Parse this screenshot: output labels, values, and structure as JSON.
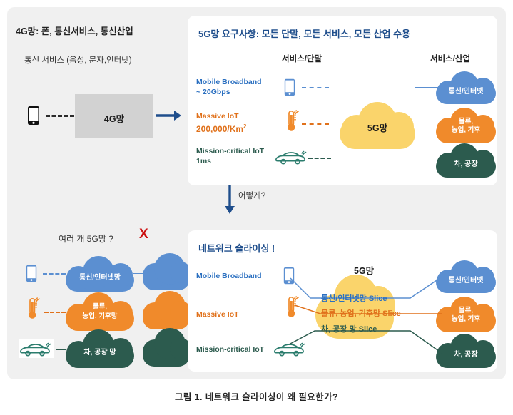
{
  "figure": {
    "caption": "그림 1.  네트워크 슬라이싱이  왜  필요한가?"
  },
  "colors": {
    "canvas_bg": "#f0f0f0",
    "panel_bg": "#ffffff",
    "blue": "#5b8fd1",
    "orange": "#f08a2b",
    "green": "#2c5b4e",
    "yellow": "#fad46b",
    "gray_cloud": "#d2d2d2",
    "navy_arrow": "#1f4e8c",
    "red_x": "#cc1111"
  },
  "panel_4g": {
    "title": "4G망: 폰, 통신서비스, 통신산업",
    "subtitle": "통신 서비스 (음성, 문자,인터넷)",
    "device_icon": "phone-icon",
    "connector": "dashed-line",
    "cloud_label": "4G망",
    "transition_icon": "right-arrow-icon"
  },
  "panel_5g_requirements": {
    "title": "5G망 요구사항: 모든 단말, 모든 서비스, 모든 산업 수용",
    "column_headers": {
      "left": "서비스/단말",
      "right": "서비스/산업"
    },
    "center_cloud_label": "5G망",
    "services": [
      {
        "name": "Mobile Broadband",
        "metric": "~ 20Gbps",
        "icon": "phone-icon",
        "color": "#2a6fc0",
        "industry_cloud": "통신/인터넷"
      },
      {
        "name": "Massive IoT",
        "metric": "200,000/Km",
        "metric_sup": "2",
        "icon": "thermometer-signal-icon",
        "color": "#e0711b",
        "industry_cloud": "물류,\n농업, 기후"
      },
      {
        "name": "Mission-critical IoT",
        "metric": "1ms",
        "icon": "car-signal-icon",
        "color": "#2c5b4e",
        "industry_cloud": "차, 공장"
      }
    ],
    "industry_clouds": [
      {
        "label": "통신/인터넷",
        "color": "#5b8fd1"
      },
      {
        "label_line1": "물류,",
        "label_line2": "농업, 기후",
        "color": "#f08a2b"
      },
      {
        "label": "차, 공장",
        "color": "#2c5b4e"
      }
    ]
  },
  "transition": {
    "arrow_icon": "down-arrow-icon",
    "label": "어떻게?"
  },
  "panel_multi_5g": {
    "question": "여러 개 5G망 ?",
    "reject_mark": "X",
    "rows": [
      {
        "icon": "phone-icon",
        "cloud_label": "통신/인터넷망",
        "color": "#5b8fd1",
        "connector": "dashed-line"
      },
      {
        "icon": "thermometer-signal-icon",
        "cloud_label": "물류,\n농업, 기후망",
        "color": "#f08a2b",
        "connector": "dashed-line"
      },
      {
        "icon": "car-signal-icon",
        "cloud_label": "차, 공장 망",
        "color": "#2c5b4e",
        "connector": "dashed-line"
      }
    ]
  },
  "panel_network_slicing": {
    "title": "네트워크 슬라이싱 !",
    "center_cloud_label": "5G망",
    "services": [
      {
        "name": "Mobile Broadband",
        "icon": "phone-icon",
        "color": "#2a6fc0"
      },
      {
        "name": "Massive IoT",
        "icon": "thermometer-signal-icon",
        "color": "#e0711b"
      },
      {
        "name": "Mission-critical IoT",
        "icon": "car-signal-icon",
        "color": "#2c5b4e"
      }
    ],
    "slices": [
      {
        "label": "통신/인터넷망 Slice",
        "color": "#2a6fc0"
      },
      {
        "label": "물류, 농업, 기후망  Slice",
        "color": "#e0711b"
      },
      {
        "label": "차, 공장 망 Slice",
        "color": "#2c5b4e"
      }
    ],
    "industry_clouds": [
      {
        "label": "통신/인터넷",
        "color": "#5b8fd1"
      },
      {
        "label_line1": "물류,",
        "label_line2": "농업, 기후",
        "color": "#f08a2b"
      },
      {
        "label": "차, 공장",
        "color": "#2c5b4e"
      }
    ]
  }
}
